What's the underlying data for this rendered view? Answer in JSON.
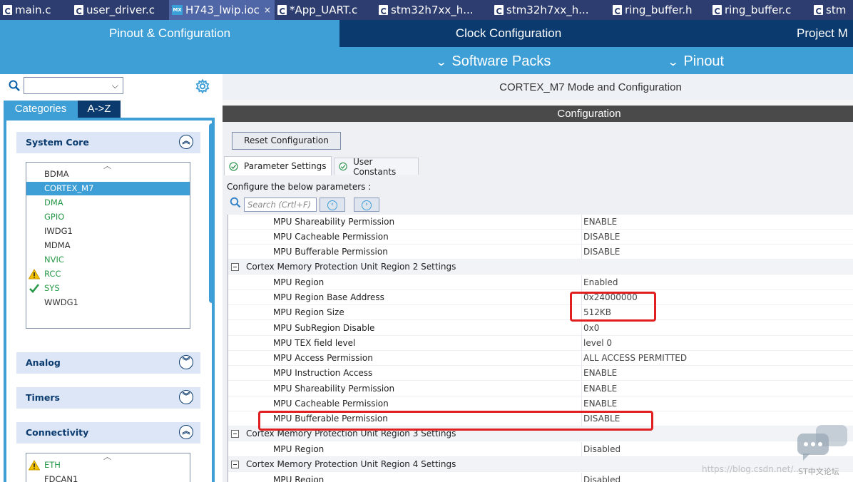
{
  "file_tabs": [
    {
      "label": "main.c",
      "icon": "c-file-icon",
      "active": false
    },
    {
      "label": "user_driver.c",
      "icon": "c-file-icon",
      "active": false
    },
    {
      "label": "H743_lwip.ioc",
      "icon": "mx-file-icon",
      "active": true
    },
    {
      "label": "*App_UART.c",
      "icon": "c-file-icon",
      "active": false
    },
    {
      "label": "stm32h7xx_h...",
      "icon": "c-file-icon",
      "active": false
    },
    {
      "label": "stm32h7xx_h...",
      "icon": "c-file-icon",
      "active": false
    },
    {
      "label": "ring_buffer.h",
      "icon": "h-file-icon",
      "active": false
    },
    {
      "label": "ring_buffer.c",
      "icon": "c-file-icon",
      "active": false
    },
    {
      "label": "stm",
      "icon": "c-file-icon",
      "active": false
    }
  ],
  "active_tab_close": "×",
  "mx_badge": "MX",
  "header": {
    "tabs": [
      "Pinout & Configuration",
      "Clock Configuration",
      "Project M"
    ],
    "sub": [
      "Software Packs",
      "Pinout"
    ]
  },
  "left": {
    "search_value": "",
    "segments": [
      "Categories",
      "A->Z"
    ],
    "categories": [
      {
        "label": "System Core",
        "expanded": true
      },
      {
        "label": "Analog",
        "expanded": false
      },
      {
        "label": "Timers",
        "expanded": false
      },
      {
        "label": "Connectivity",
        "expanded": true
      }
    ],
    "system_core_items": [
      {
        "label": "BDMA",
        "state": "normal"
      },
      {
        "label": "CORTEX_M7",
        "state": "selected"
      },
      {
        "label": "DMA",
        "state": "green"
      },
      {
        "label": "GPIO",
        "state": "green"
      },
      {
        "label": "IWDG1",
        "state": "normal"
      },
      {
        "label": "MDMA",
        "state": "normal"
      },
      {
        "label": "NVIC",
        "state": "green"
      },
      {
        "label": "RCC",
        "state": "warning"
      },
      {
        "label": "SYS",
        "state": "check"
      },
      {
        "label": "WWDG1",
        "state": "normal"
      }
    ],
    "connectivity_items": [
      {
        "label": "ETH",
        "state": "warning"
      },
      {
        "label": "FDCAN1",
        "state": "normal"
      }
    ]
  },
  "right": {
    "title": "CORTEX_M7 Mode and Configuration",
    "config_bar": "Configuration",
    "reset_label": "Reset Configuration",
    "tabs": [
      "Parameter Settings",
      "User Constants"
    ],
    "params_label": "Configure the below parameters :",
    "search_placeholder": "Search (Crtl+F)",
    "rows": [
      {
        "type": "item",
        "key": "MPU Shareability Permission",
        "value": "ENABLE"
      },
      {
        "type": "item",
        "key": "MPU Cacheable Permission",
        "value": "DISABLE"
      },
      {
        "type": "item",
        "key": "MPU Bufferable  Permission",
        "value": "DISABLE"
      },
      {
        "type": "section",
        "key": "Cortex Memory Protection Unit Region 2 Settings",
        "value": ""
      },
      {
        "type": "item",
        "key": "MPU Region",
        "value": "Enabled"
      },
      {
        "type": "item",
        "key": "MPU Region Base Address",
        "value": "0x24000000"
      },
      {
        "type": "item",
        "key": "MPU Region Size",
        "value": "512KB"
      },
      {
        "type": "item",
        "key": "MPU SubRegion Disable",
        "value": "0x0"
      },
      {
        "type": "item",
        "key": "MPU TEX field level",
        "value": "level 0"
      },
      {
        "type": "item",
        "key": "MPU Access Permission",
        "value": "ALL ACCESS PERMITTED"
      },
      {
        "type": "item",
        "key": "MPU Instruction Access",
        "value": "ENABLE"
      },
      {
        "type": "item",
        "key": "MPU Shareability Permission",
        "value": "ENABLE"
      },
      {
        "type": "item",
        "key": "MPU Cacheable Permission",
        "value": "ENABLE"
      },
      {
        "type": "item",
        "key": "MPU Bufferable  Permission",
        "value": "DISABLE"
      },
      {
        "type": "section",
        "key": "Cortex Memory Protection Unit Region 3 Settings",
        "value": ""
      },
      {
        "type": "item",
        "key": "MPU Region",
        "value": "Disabled"
      },
      {
        "type": "section",
        "key": "Cortex Memory Protection Unit Region 4 Settings",
        "value": ""
      },
      {
        "type": "item",
        "key": "MPU Region",
        "value": "Disabled"
      }
    ]
  },
  "watermark": "https://blog.csdn.net/...",
  "watermark_badge": "ST中文论坛",
  "colors": {
    "accent": "#3e9fd6",
    "navy": "#0b3b6e",
    "highlight": "#e02020"
  }
}
